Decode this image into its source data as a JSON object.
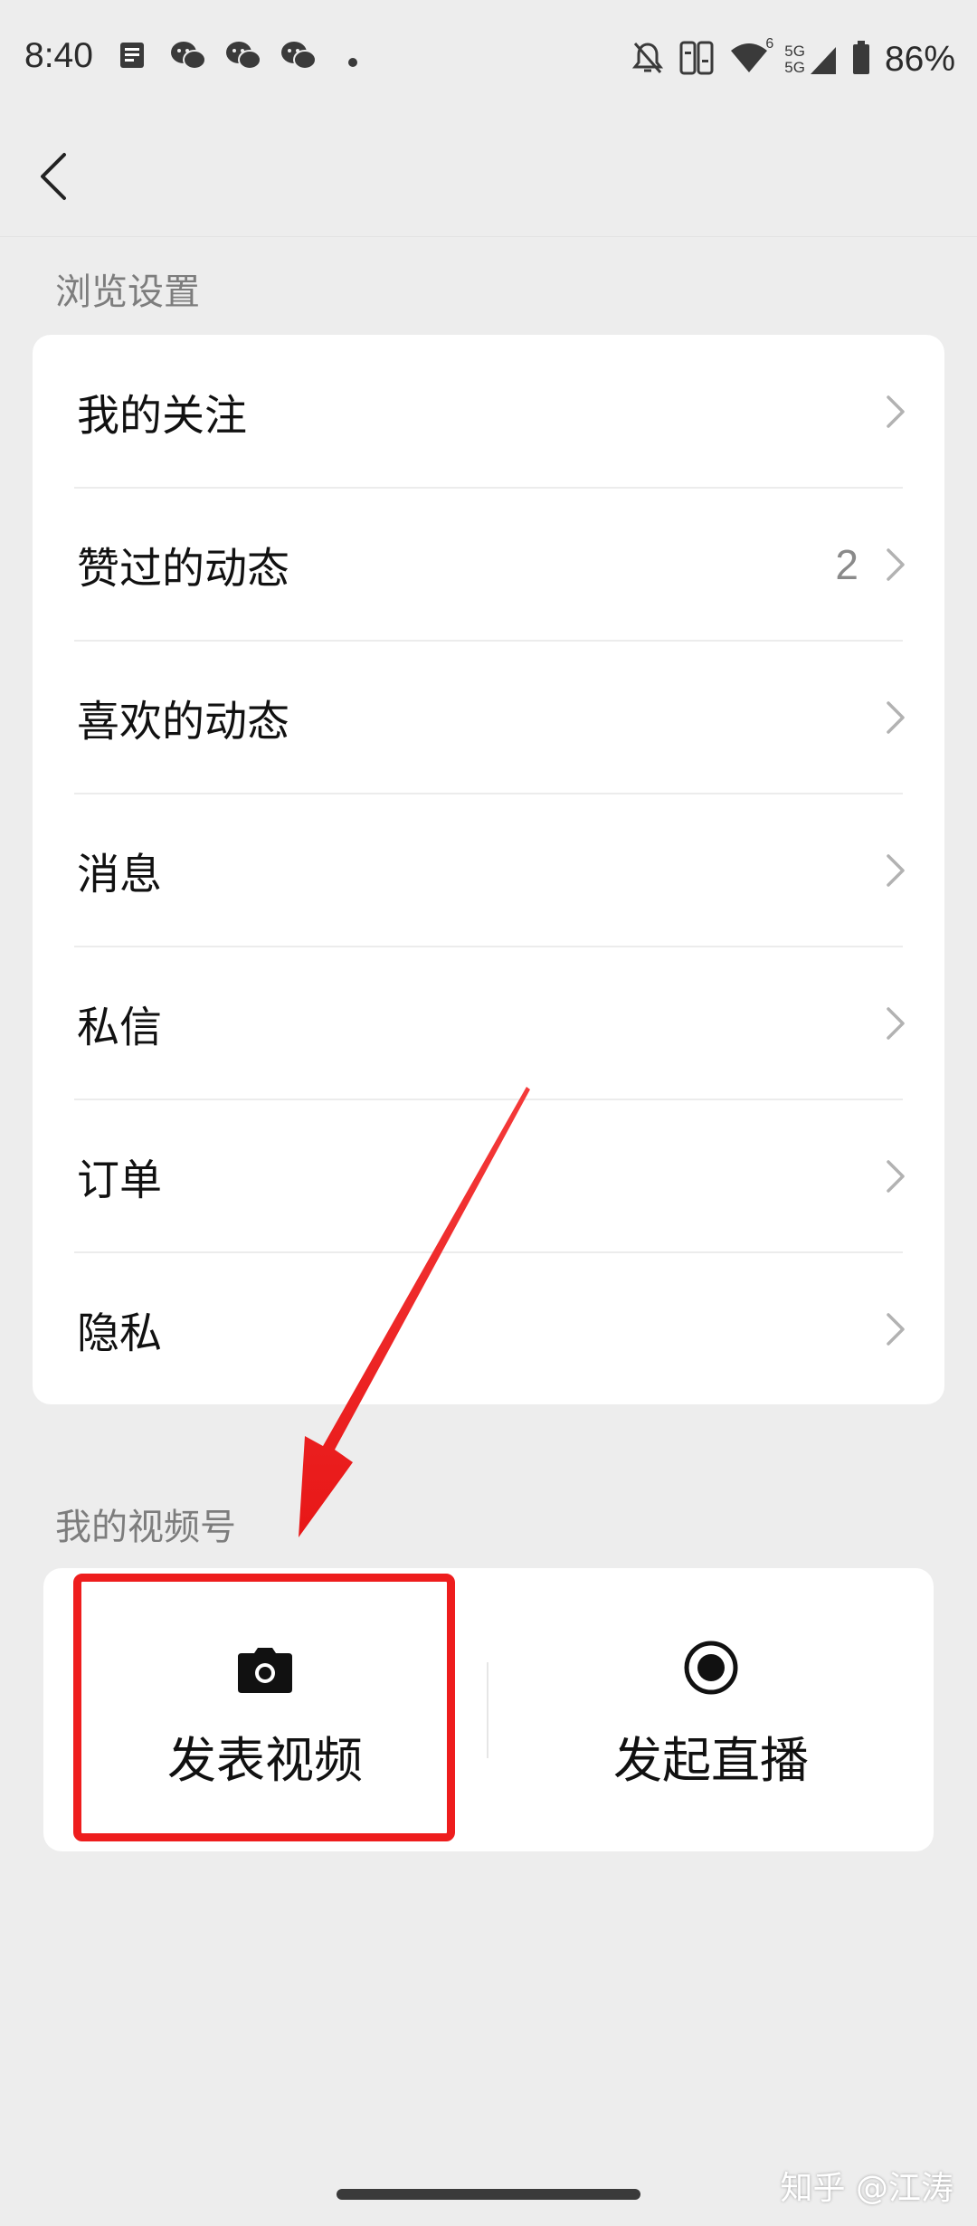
{
  "status_bar": {
    "time": "8:40",
    "battery": "86%",
    "network_label": "5G",
    "wifi_label": "6",
    "left_icons": [
      "note-icon",
      "wechat-icon",
      "wechat-icon",
      "wechat-icon",
      "dot-icon"
    ],
    "right_icons": [
      "bell-off-icon",
      "hd-icon",
      "wifi-icon",
      "signal-icon",
      "battery-icon"
    ]
  },
  "nav": {
    "back_icon": "back-arrow-icon"
  },
  "browse_section": {
    "title": "浏览设置",
    "items": [
      {
        "label": "我的关注",
        "badge": ""
      },
      {
        "label": "赞过的动态",
        "badge": "2"
      },
      {
        "label": "喜欢的动态",
        "badge": ""
      },
      {
        "label": "消息",
        "badge": ""
      },
      {
        "label": "私信",
        "badge": ""
      },
      {
        "label": "订单",
        "badge": ""
      },
      {
        "label": "隐私",
        "badge": ""
      }
    ]
  },
  "channel_section": {
    "title": "我的视频号",
    "publish_video": {
      "label": "发表视频",
      "icon": "camera-icon"
    },
    "start_live": {
      "label": "发起直播",
      "icon": "record-icon"
    }
  },
  "annotation": {
    "highlight_color": "#ee1d1d"
  },
  "watermark": "知乎 @江涛"
}
